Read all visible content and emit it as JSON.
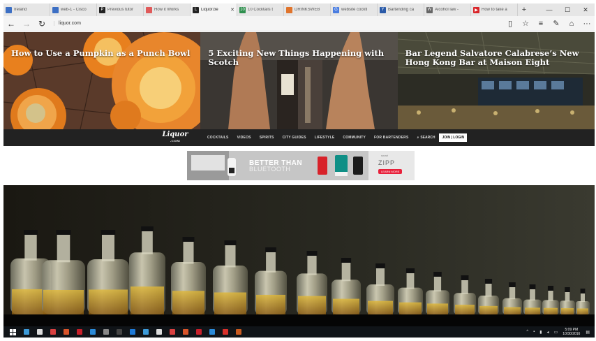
{
  "browser": {
    "tabs": [
      {
        "label": "Ireland",
        "fav_color": "#3c6fc4",
        "fav_glyph": ""
      },
      {
        "label": "web-1 - Cisco",
        "fav_color": "#3c6fc4",
        "fav_glyph": ""
      },
      {
        "label": "Previous tutor",
        "fav_color": "#222222",
        "fav_glyph": "P"
      },
      {
        "label": "How it Works",
        "fav_color": "#e05a5a",
        "fav_glyph": ""
      },
      {
        "label": "Liquor.be",
        "fav_color": "#222222",
        "fav_glyph": "L",
        "active": true
      },
      {
        "label": "10 Cocktails t",
        "fav_color": "#2f8f4e",
        "fav_glyph": "10"
      },
      {
        "label": "DRINKSWEB",
        "fav_color": "#e0742c",
        "fav_glyph": ""
      },
      {
        "label": "website cocktl",
        "fav_color": "#4a7de0",
        "fav_glyph": "G"
      },
      {
        "label": "Bartending ca",
        "fav_color": "#2a5aa8",
        "fav_glyph": "Y"
      },
      {
        "label": "Alcohol law -",
        "fav_color": "#666666",
        "fav_glyph": "W"
      },
      {
        "label": "How to take a",
        "fav_color": "#d9252a",
        "fav_glyph": "▶"
      }
    ],
    "address": "liquor.com"
  },
  "hero": [
    {
      "title": "How to Use a Pumpkin as a Punch Bowl"
    },
    {
      "title": "5 Exciting New Things Happening with Scotch"
    },
    {
      "title": "Bar Legend Salvatore Calabrese’s New Hong Kong Bar at Maison Eight"
    }
  ],
  "site_nav": {
    "logo": "Liquor",
    "logo_sub": ".COM",
    "items": [
      "COCKTAILS",
      "VIDEOS",
      "SPIRITS",
      "CITY GUIDES",
      "LIFESTYLE",
      "COMMUNITY",
      "FOR BARTENDERS"
    ],
    "search_label": "SEARCH",
    "join_label": "JOIN | LOGIN"
  },
  "ad": {
    "headline": "BETTER THAN",
    "subline": "BLUETOOTH",
    "brand_small": "smart",
    "brand": "ZIPP",
    "cta": "LEARN MORE"
  },
  "taskbar": {
    "time": "5:09 PM",
    "date": "10/30/2016"
  }
}
